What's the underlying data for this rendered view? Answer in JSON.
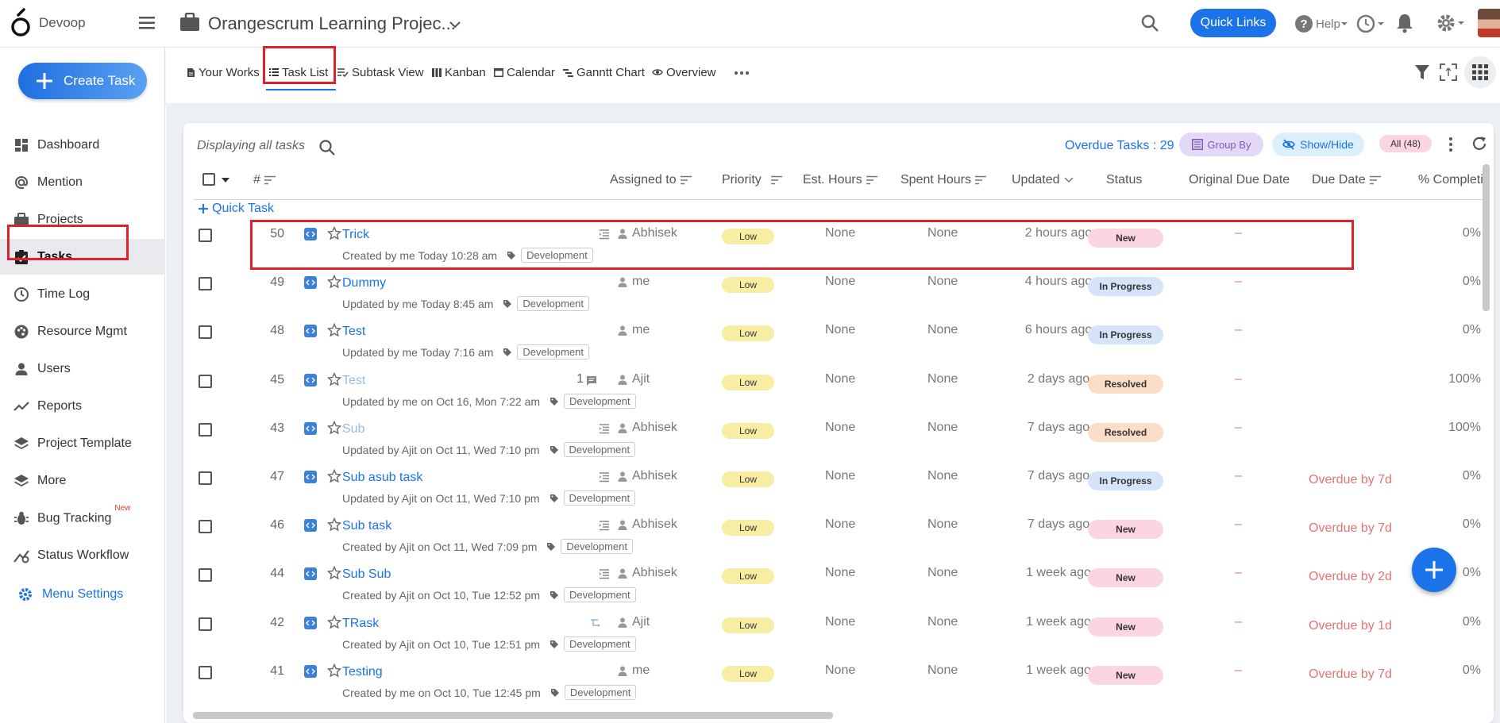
{
  "app": {
    "brand": "Devoop",
    "project_title": "Orangescrum Learning Projec...",
    "quick_links": "Quick Links",
    "help": "Help"
  },
  "sidebar": {
    "create_task": "Create Task",
    "items": [
      {
        "label": "Dashboard",
        "icon": "dashboard-icon"
      },
      {
        "label": "Mention",
        "icon": "at-icon"
      },
      {
        "label": "Projects",
        "icon": "briefcase-icon"
      },
      {
        "label": "Tasks",
        "icon": "clipboard-check-icon",
        "active": true
      },
      {
        "label": "Time Log",
        "icon": "clock-icon"
      },
      {
        "label": "Resource Mgmt",
        "icon": "palette-icon"
      },
      {
        "label": "Users",
        "icon": "user-icon"
      },
      {
        "label": "Reports",
        "icon": "trend-icon"
      },
      {
        "label": "Project Template",
        "icon": "layers-icon"
      },
      {
        "label": "More",
        "icon": "layers-icon"
      },
      {
        "label": "Bug Tracking",
        "icon": "bug-icon",
        "badge": "New"
      },
      {
        "label": "Status Workflow",
        "icon": "workflow-icon"
      }
    ],
    "menu_settings": "Menu Settings"
  },
  "tabs": [
    {
      "label": "Your Works",
      "icon": "doc-icon"
    },
    {
      "label": "Task List",
      "icon": "list-icon",
      "active": true
    },
    {
      "label": "Subtask View",
      "icon": "subtask-icon"
    },
    {
      "label": "Kanban",
      "icon": "kanban-icon"
    },
    {
      "label": "Calendar",
      "icon": "calendar-icon"
    },
    {
      "label": "Ganntt Chart",
      "icon": "gantt-icon"
    },
    {
      "label": "Overview",
      "icon": "eye-icon"
    }
  ],
  "toolbar": {
    "displaying": "Displaying all tasks",
    "overdue": "Overdue Tasks : 29",
    "group_by": "Group By",
    "show_hide": "Show/Hide",
    "all_count": "All (48)",
    "quick_task": "Quick Task"
  },
  "columns": {
    "num": "#",
    "assigned": "Assigned to",
    "priority": "Priority",
    "est": "Est. Hours",
    "spent": "Spent Hours",
    "updated": "Updated",
    "status": "Status",
    "orig_due": "Original Due Date",
    "due": "Due Date",
    "pct": "% Completio"
  },
  "rows": [
    {
      "num": "50",
      "title": "Trick",
      "sub": "Created by me Today 10:28 am",
      "tag": "Development",
      "assignee": "Abhisek",
      "priority": "Low",
      "est": "None",
      "spent": "None",
      "updated": "2 hours ago",
      "status": "New",
      "orig_due": "–",
      "due": "",
      "pct": "0%",
      "meta": "checklist"
    },
    {
      "num": "49",
      "title": "Dummy",
      "sub": "Updated by me Today 8:45 am",
      "tag": "Development",
      "assignee": "me",
      "priority": "Low",
      "est": "None",
      "spent": "None",
      "updated": "4 hours ago",
      "status": "In Progress",
      "orig_due": "–",
      "due": "",
      "pct": "0%",
      "meta": ""
    },
    {
      "num": "48",
      "title": "Test",
      "sub": "Updated by me Today 7:16 am",
      "tag": "Development",
      "assignee": "me",
      "priority": "Low",
      "est": "None",
      "spent": "None",
      "updated": "6 hours ago",
      "status": "In Progress",
      "orig_due": "–",
      "due": "",
      "pct": "0%",
      "meta": ""
    },
    {
      "num": "45",
      "title": "Test",
      "sub": "Updated by me on Oct 16, Mon 7:22 am",
      "tag": "Development",
      "assignee": "Ajit",
      "priority": "Low",
      "est": "None",
      "spent": "None",
      "updated": "2 days ago",
      "status": "Resolved",
      "orig_due": "–",
      "due": "",
      "pct": "100%",
      "meta": "comment",
      "comments": "1",
      "dim": true
    },
    {
      "num": "43",
      "title": "Sub",
      "sub": "Updated by Ajit on Oct 11, Wed 7:10 pm",
      "tag": "Development",
      "assignee": "Abhisek",
      "priority": "Low",
      "est": "None",
      "spent": "None",
      "updated": "7 days ago",
      "status": "Resolved",
      "orig_due": "–",
      "due": "",
      "pct": "100%",
      "meta": "checklist",
      "dim": true
    },
    {
      "num": "47",
      "title": "Sub asub task",
      "sub": "Updated by Ajit on Oct 11, Wed 7:10 pm",
      "tag": "Development",
      "assignee": "Abhisek",
      "priority": "Low",
      "est": "None",
      "spent": "None",
      "updated": "7 days ago",
      "status": "In Progress",
      "orig_due": "–",
      "due": "Overdue by 7d",
      "pct": "0%",
      "meta": "checklist"
    },
    {
      "num": "46",
      "title": "Sub task",
      "sub": "Created by Ajit on Oct 11, Wed 7:09 pm",
      "tag": "Development",
      "assignee": "Abhisek",
      "priority": "Low",
      "est": "None",
      "spent": "None",
      "updated": "7 days ago",
      "status": "New",
      "orig_due": "–",
      "due": "Overdue by 7d",
      "pct": "0%",
      "meta": "checklist"
    },
    {
      "num": "44",
      "title": "Sub Sub",
      "sub": "Created by Ajit on Oct 10, Tue 12:52 pm",
      "tag": "Development",
      "assignee": "Abhisek",
      "priority": "Low",
      "est": "None",
      "spent": "None",
      "updated": "1 week ago",
      "status": "New",
      "orig_due": "–",
      "due": "Overdue by 2d",
      "pct": "0%",
      "meta": "checklist"
    },
    {
      "num": "42",
      "title": "TRask",
      "sub": "Created by Ajit on Oct 10, Tue 12:51 pm",
      "tag": "Development",
      "assignee": "Ajit",
      "priority": "Low",
      "est": "None",
      "spent": "None",
      "updated": "1 week ago",
      "status": "New",
      "orig_due": "–",
      "due": "Overdue by 1d",
      "pct": "0%",
      "meta": "subtask"
    },
    {
      "num": "41",
      "title": "Testing",
      "sub": "Created by me on Oct 10, Tue 12:45 pm",
      "tag": "Development",
      "assignee": "me",
      "priority": "Low",
      "est": "None",
      "spent": "None",
      "updated": "1 week ago",
      "status": "New",
      "orig_due": "–",
      "due": "Overdue by 7d",
      "pct": "0%",
      "meta": ""
    }
  ],
  "colors": {
    "accent": "#1a73e8",
    "highlight": "#e0202a",
    "overdue": "#e57373",
    "priority_low": "#f7eda3",
    "status_new": "#fbd5df",
    "status_in_progress": "#d4e5fa",
    "status_resolved": "#fbddc8"
  }
}
